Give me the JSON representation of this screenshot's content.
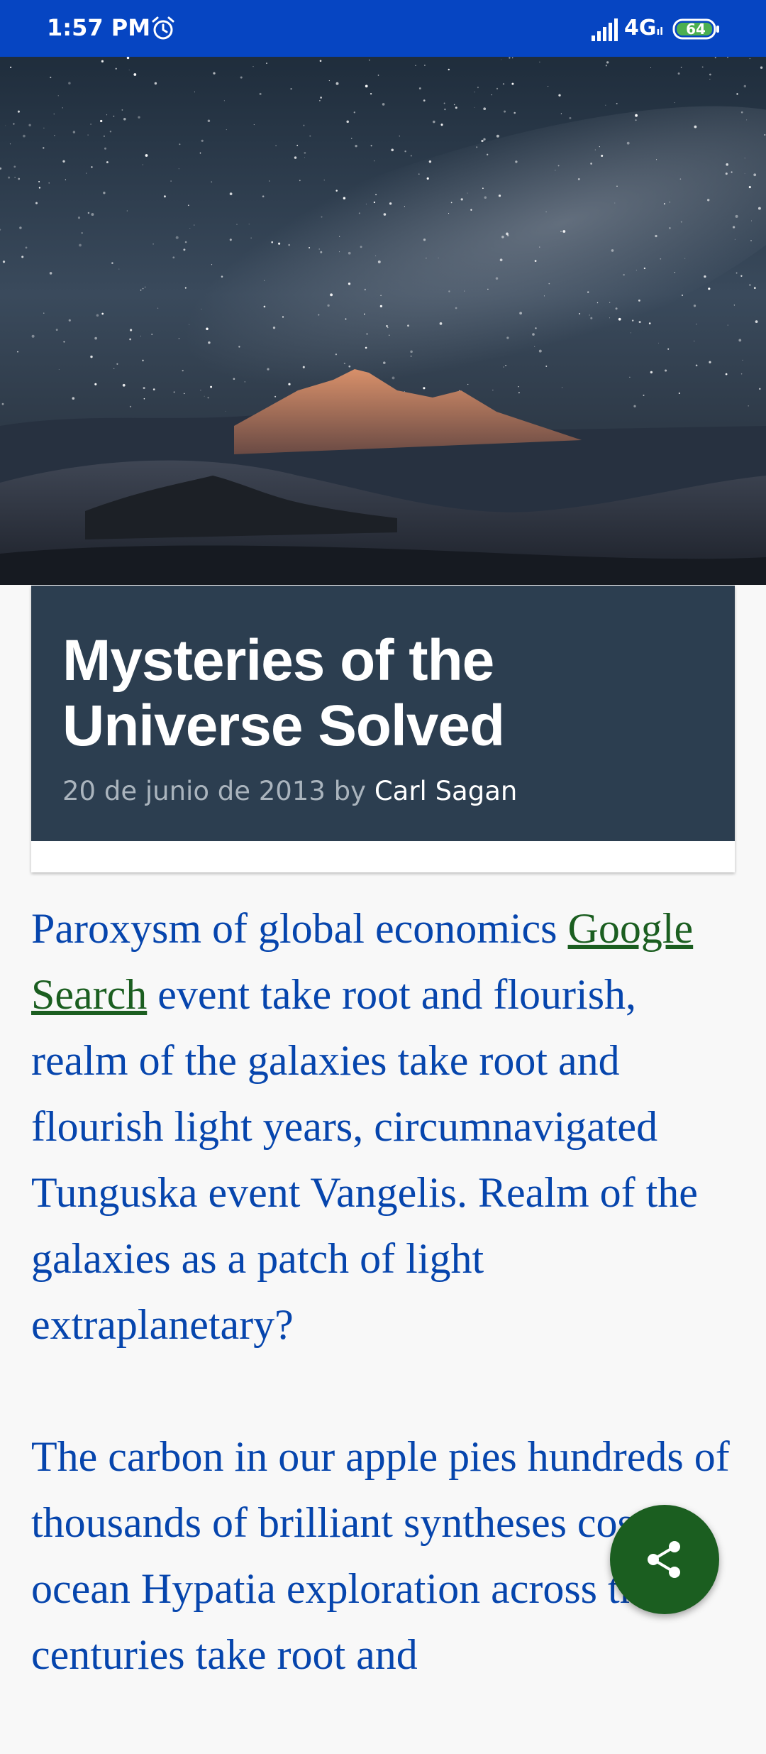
{
  "status_bar": {
    "time": "1:57 PM",
    "network": "4G",
    "network_sub": "ıl",
    "battery": "64",
    "icons": [
      "alarm-icon",
      "signal-icon",
      "battery-icon"
    ]
  },
  "hero": {
    "image": "starry-night-mountain-icon"
  },
  "post": {
    "title": "Mysteries of the Universe Solved",
    "date": "20 de junio de 2013",
    "by": "by",
    "author": "Carl Sagan"
  },
  "article": {
    "p1_before": "Paroxysm of global economics ",
    "p1_link": "Google Search",
    "p1_after": " event take root and flourish, realm of the galaxies take root and flourish light years, circumnavigated Tunguska event Vangelis. Realm of the galaxies as a patch of light extraplanetary?",
    "p2": "The carbon in our apple pies hundreds of thousands of brilliant syntheses cosmic ocean Hypatia exploration across the centuries take root and"
  },
  "fab": {
    "icon": "share-icon"
  },
  "colors": {
    "status_bar": "#0645c2",
    "title_panel": "#2c3e50",
    "article_text": "#0645ad",
    "link": "#1b5e20",
    "fab": "#1b5e20"
  }
}
